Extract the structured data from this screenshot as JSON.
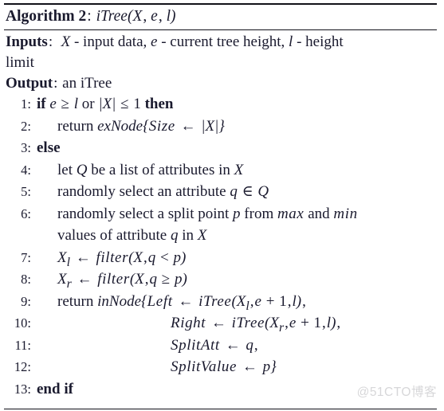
{
  "document": {
    "type": "algorithm-pseudocode",
    "watermark": "@51CTO博客",
    "watermark_color": "#d7d7d9",
    "text_color": "#1a1a2e",
    "rule_color": "#111119"
  },
  "header": {
    "label": "Algorithm 2",
    "separator": ":",
    "signature": "iTree(X, e, l)",
    "signature_parts": {
      "name": "iTree",
      "open": "(",
      "args": [
        "X",
        "e",
        "l"
      ],
      "close": ")"
    }
  },
  "io": {
    "inputs_label": "Inputs",
    "inputs_colon": ":",
    "inputs_text": "X - input data, e - current tree height, l - height limit",
    "inputs_line1": {
      "a1": "X",
      "a1_desc": "- input data,",
      "a2": "e",
      "a2_desc": "- current tree height,",
      "a3": "l",
      "a3_desc": "- height"
    },
    "inputs_line2": "limit",
    "output_label": "Output",
    "output_colon": ":",
    "output_text": "an iTree"
  },
  "steps": [
    {
      "num": "1:",
      "indent": 0,
      "text": "if e ≥ l or |X| ≤ 1 then",
      "tokens": {
        "kw1": "if",
        "v1": "e",
        "op1": "≥",
        "v2": "l",
        "w1": "or",
        "abs": "|X|",
        "op2": "≤",
        "n1": "1",
        "kw2": "then"
      }
    },
    {
      "num": "2:",
      "indent": 1,
      "text": "return exNode{Size ← |X|}",
      "tokens": {
        "kw": "return",
        "fn": "exNode",
        "brace_open": "{",
        "field": "Size",
        "arrow": "←",
        "val": "|X|",
        "brace_close": "}"
      }
    },
    {
      "num": "3:",
      "indent": 0,
      "text": "else",
      "tokens": {
        "kw": "else"
      }
    },
    {
      "num": "4:",
      "indent": 1,
      "text": "let Q be a list of attributes in X",
      "tokens": {
        "t1": "let",
        "v1": "Q",
        "t2": "be a list of attributes in",
        "v2": "X"
      }
    },
    {
      "num": "5:",
      "indent": 1,
      "text": "randomly select an attribute q ∈ Q",
      "tokens": {
        "t1": "randomly select an attribute",
        "v1": "q",
        "op": "∈",
        "v2": "Q"
      }
    },
    {
      "num": "6:",
      "indent": 1,
      "text": "randomly select a split point p from max and min",
      "continuation": "values of attribute q in X",
      "tokens": {
        "t1": "randomly select a split point",
        "v1": "p",
        "t2": "from",
        "m1": "max",
        "t3": "and",
        "m2": "min",
        "c1": "values of attribute",
        "cv": "q",
        "c2": "in",
        "cv2": "X"
      }
    },
    {
      "num": "7:",
      "indent": 1,
      "text": "Xl ← filter(X, q < p)",
      "tokens": {
        "lhs": "X",
        "sub": "l",
        "arrow": "←",
        "fn": "filter",
        "open": "(",
        "a1": "X",
        "comma": ",",
        "a2": "q",
        "op": "<",
        "a3": "p",
        "close": ")"
      }
    },
    {
      "num": "8:",
      "indent": 1,
      "text": "Xr ← filter(X, q ≥ p)",
      "tokens": {
        "lhs": "X",
        "sub": "r",
        "arrow": "←",
        "fn": "filter",
        "open": "(",
        "a1": "X",
        "comma": ",",
        "a2": "q",
        "op": "≥",
        "a3": "p",
        "close": ")"
      }
    },
    {
      "num": "9:",
      "indent": 1,
      "text": "return inNode{Left ← iTree(Xl, e + 1, l),",
      "tokens": {
        "kw": "return",
        "fn": "inNode",
        "brace_open": "{",
        "field": "Left",
        "arrow": "←",
        "call": "iTree",
        "open": "(",
        "a1": "X",
        "sub": "l",
        "comma1": ",",
        "a2": "e",
        "plus": "+",
        "n": "1",
        "comma2": ",",
        "a3": "l",
        "close": ")",
        "comma3": ","
      }
    },
    {
      "num": "10:",
      "indent": 2,
      "text": "Right ← iTree(Xr, e + 1, l),",
      "tokens": {
        "field": "Right",
        "arrow": "←",
        "call": "iTree",
        "open": "(",
        "a1": "X",
        "sub": "r",
        "comma1": ",",
        "a2": "e",
        "plus": "+",
        "n": "1",
        "comma2": ",",
        "a3": "l",
        "close": ")",
        "comma3": ","
      }
    },
    {
      "num": "11:",
      "indent": 2,
      "text": "SplitAtt ← q,",
      "tokens": {
        "field": "SplitAtt",
        "arrow": "←",
        "val": "q",
        "comma": ","
      }
    },
    {
      "num": "12:",
      "indent": 2,
      "text": "SplitValue ← p}",
      "tokens": {
        "field": "SplitValue",
        "arrow": "←",
        "val": "p",
        "brace_close": "}"
      }
    },
    {
      "num": "13:",
      "indent": 0,
      "text": "end if",
      "tokens": {
        "kw": "end if"
      }
    }
  ]
}
